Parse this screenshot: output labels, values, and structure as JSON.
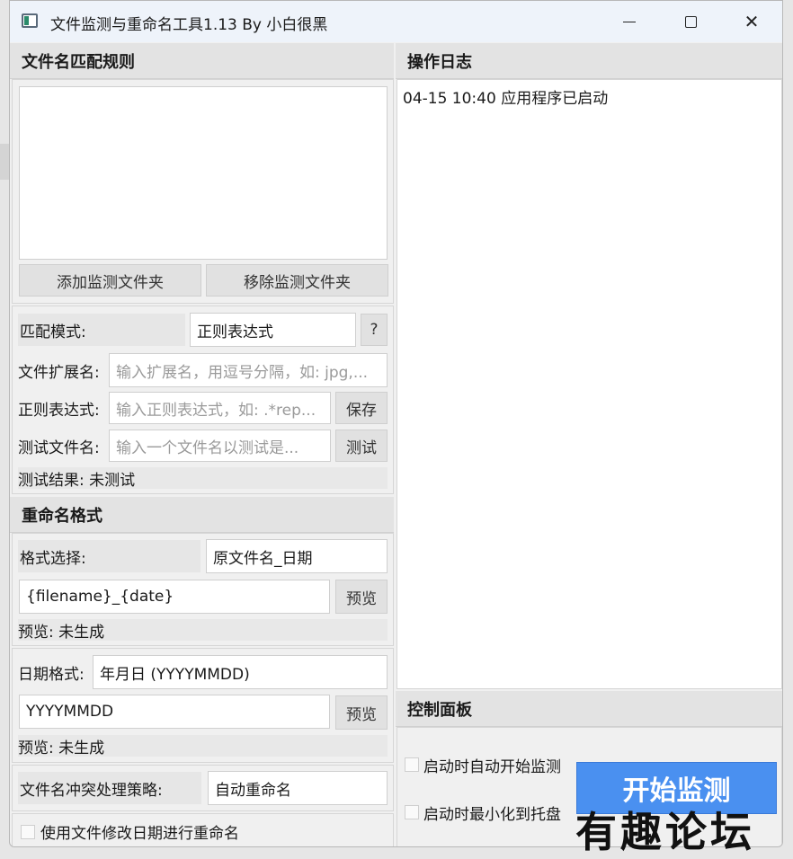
{
  "window": {
    "title": "文件监测与重命名工具1.13 By 小白很黑",
    "close_glyph": "✕"
  },
  "left": {
    "match_rules_header": "文件名匹配规则",
    "add_folder_label": "添加监测文件夹",
    "remove_folder_label": "移除监测文件夹",
    "match_mode_label": "匹配模式:",
    "match_mode_value": "正则表达式",
    "help_label": "?",
    "ext_label": "文件扩展名:",
    "ext_placeholder": "输入扩展名，用逗号分隔，如: jpg,...",
    "regex_label": "正则表达式:",
    "regex_placeholder": "输入正则表达式，如: .*rep...",
    "save_label": "保存",
    "test_name_label": "测试文件名:",
    "test_name_placeholder": "输入一个文件名以测试是...",
    "test_label": "测试",
    "test_result": "测试结果: 未测试",
    "rename_header": "重命名格式",
    "format_select_label": "格式选择:",
    "format_select_value": "原文件名_日期",
    "format_template": "{filename}_{date}",
    "preview_button": "预览",
    "preview_result": "预览: 未生成",
    "date_format_label": "日期格式:",
    "date_format_value": "年月日 (YYYYMMDD)",
    "date_template": "YYYYMMDD",
    "date_preview_button": "预览",
    "date_preview_result": "预览: 未生成",
    "conflict_label": "文件名冲突处理策略:",
    "conflict_value": "自动重命名",
    "use_mod_date_label": "使用文件修改日期进行重命名"
  },
  "right": {
    "log_header": "操作日志",
    "log_lines": [
      "04-15 10:40 应用程序已启动"
    ],
    "control_header": "控制面板",
    "auto_start_label": "启动时自动开始监测",
    "minimize_label": "启动时最小化到托盘",
    "start_button": "开始监测"
  },
  "watermark": "有趣论坛",
  "colors": {
    "accent_button": "#4a90f0",
    "titlebar": "#eef3fa",
    "header_bg": "#e3e3e3"
  }
}
